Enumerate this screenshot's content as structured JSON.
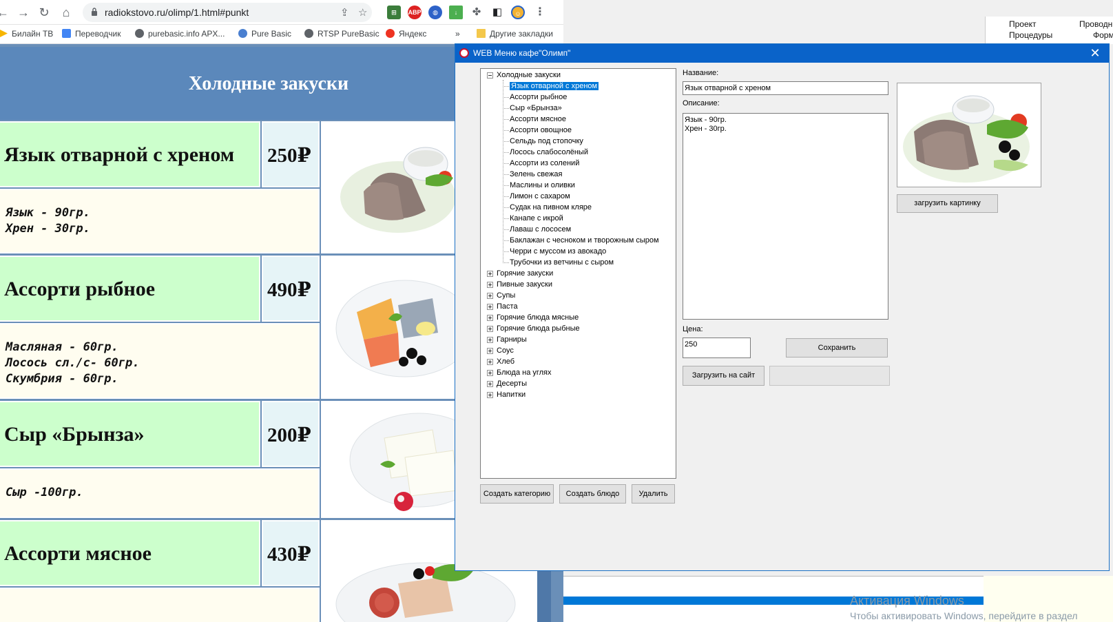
{
  "browser": {
    "url": "radiokstovo.ru/olimp/1.html#punkt",
    "bookmarks": [
      {
        "label": "Билайн ТВ",
        "color": "#f7b500"
      },
      {
        "label": "Переводчик",
        "color": "#4285f4"
      },
      {
        "label": "purebasic.info APX...",
        "color": "#5f6368"
      },
      {
        "label": "Pure Basic",
        "color": "#4a7fd0"
      },
      {
        "label": "RTSP PureBasic",
        "color": "#5f6368"
      },
      {
        "label": "Яндекс",
        "color": "#e32"
      }
    ],
    "more_bookmarks": "»",
    "other_bookmarks": "Другие закладки"
  },
  "webpage": {
    "section_title": "Холодные закуски",
    "dishes": [
      {
        "name": "Язык отварной с хреном",
        "price": "250₽",
        "desc": [
          "Язык - 90гр.",
          "Хрен - 30гр."
        ]
      },
      {
        "name": "Ассорти рыбное",
        "price": "490₽",
        "desc": [
          "Масляная - 60гр.",
          "Лосось сл./с- 60гр.",
          "Скумбрия - 60гр."
        ]
      },
      {
        "name": "Сыр «Брынза»",
        "price": "200₽",
        "desc": [
          "Сыр -100гр."
        ]
      },
      {
        "name": "Ассорти мясное",
        "price": "430₽",
        "desc": []
      }
    ]
  },
  "ide": {
    "tab_project": "Проект",
    "tab_explorer": "Проводни",
    "tab_procedures": "Процедуры",
    "tab_form": "Форм",
    "activation_title": "Активация Windows",
    "activation_text": "Чтобы активировать Windows, перейдите в раздел"
  },
  "dialog": {
    "title": "WEB Меню кафе\"Олимп\"",
    "close_glyph": "✕",
    "tree": {
      "expanded_category": "Холодные закуски",
      "items": [
        "Язык отварной с хреном",
        "Ассорти рыбное",
        "Сыр «Брынза»",
        "Ассорти мясное",
        "Ассорти овощное",
        "Сельдь под стопочку",
        "Лосось слабосолёный",
        "Ассорти из солений",
        "Зелень свежая",
        "Маслины и оливки",
        "Лимон с сахаром",
        "Судак на  пивном кляре",
        "Канапе с икрой",
        "Лаваш с лососем",
        "Баклажан с чесноком и творожным сыром",
        "Черри с муссом из авокадо",
        "Трубочки из ветчины с сыром"
      ],
      "selected_index": 0,
      "categories": [
        "Горячие закуски",
        "Пивные закуски",
        "Супы",
        "Паста",
        "Горячие блюда мясные",
        "Горячие блюда рыбные",
        "Гарниры",
        "Соус",
        "Хлеб",
        "Блюда на углях",
        "Десерты",
        "Напитки"
      ]
    },
    "name_label": "Название:",
    "name_value": "Язык отварной с хреном",
    "desc_label": "Описание:",
    "desc_lines": [
      "Язык - 90гр.",
      "Хрен - 30гр."
    ],
    "price_label": "Цена:",
    "price_value": "250",
    "buttons": {
      "load_image": "загрузить картинку",
      "save": "Сохранить",
      "upload": "Загрузить на сайт",
      "create_category": "Создать категорию",
      "create_dish": "Создать блюдо",
      "delete": "Удалить"
    }
  }
}
